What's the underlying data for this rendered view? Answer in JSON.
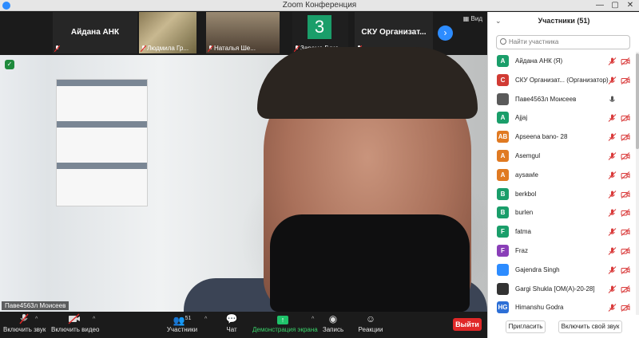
{
  "window": {
    "title": "Zoom Конференция",
    "minimize_glyph": "—",
    "maximize_glyph": "▢",
    "close_glyph": "✕"
  },
  "strip": {
    "tiles": [
      {
        "name": "Айдана АНК",
        "label": ""
      },
      {
        "name": "",
        "label": "Людмила Гр..."
      },
      {
        "name": "",
        "label": "Наталья Ше..."
      },
      {
        "name": "3",
        "label": "Зарема Гума..."
      },
      {
        "name": "СКУ  Организат...",
        "label": ""
      }
    ],
    "next_glyph": "›",
    "view_label": "Вид"
  },
  "main_video": {
    "speaker_label": "Паве4563л Моисеев",
    "shield_glyph": "✓"
  },
  "toolbar": {
    "mute_label": "Включить звук",
    "video_label": "Включить видео",
    "participants_label": "Участники",
    "participants_count": "51",
    "chat_label": "Чат",
    "share_label": "Демонстрация экрана",
    "record_label": "Запись",
    "reactions_label": "Реакции",
    "end_label": "Выйти",
    "caret_glyph": "^",
    "share_glyph": "↑"
  },
  "panel": {
    "title": "Участники (51)",
    "collapse_glyph": "⌄",
    "search_placeholder": "Найти участника",
    "invite_label": "Пригласить",
    "unmute_self_label": "Включить свой звук",
    "participants": [
      {
        "initials": "A",
        "color": "#1a9e6a",
        "name": "Айдана АНК (Я)",
        "mic": "muted",
        "video": "off"
      },
      {
        "initials": "C",
        "color": "#d13b34",
        "name": "СКУ Организат...  (Организатор)",
        "mic": "muted",
        "video": "off"
      },
      {
        "initials": "",
        "color": "#5a5a5a",
        "name": "Паве4563л Моисеев",
        "mic": "on",
        "video": "on"
      },
      {
        "initials": "A",
        "color": "#1a9e6a",
        "name": "Ajjaj",
        "mic": "muted",
        "video": "off"
      },
      {
        "initials": "AB",
        "color": "#e07a22",
        "name": "Apseena bano- 28",
        "mic": "muted",
        "video": "off"
      },
      {
        "initials": "A",
        "color": "#e07a22",
        "name": "Asemgul",
        "mic": "muted",
        "video": "off"
      },
      {
        "initials": "A",
        "color": "#e07a22",
        "name": "aysawle",
        "mic": "muted",
        "video": "off"
      },
      {
        "initials": "B",
        "color": "#1a9e6a",
        "name": "berkbol",
        "mic": "muted",
        "video": "off"
      },
      {
        "initials": "B",
        "color": "#1a9e6a",
        "name": "burlen",
        "mic": "muted",
        "video": "off"
      },
      {
        "initials": "F",
        "color": "#1a9e6a",
        "name": "fatma",
        "mic": "muted",
        "video": "off"
      },
      {
        "initials": "F",
        "color": "#8a3fb8",
        "name": "Fraz",
        "mic": "muted",
        "video": "off"
      },
      {
        "initials": "",
        "color": "#2d8cff",
        "name": "Gajendra Singh",
        "mic": "muted",
        "video": "off"
      },
      {
        "initials": "",
        "color": "#333333",
        "name": "Gargi Shukla [OM(A)-20-28]",
        "mic": "muted",
        "video": "off"
      },
      {
        "initials": "HG",
        "color": "#2d6fd6",
        "name": "Himanshu Godra",
        "mic": "muted",
        "video": "off"
      }
    ]
  }
}
